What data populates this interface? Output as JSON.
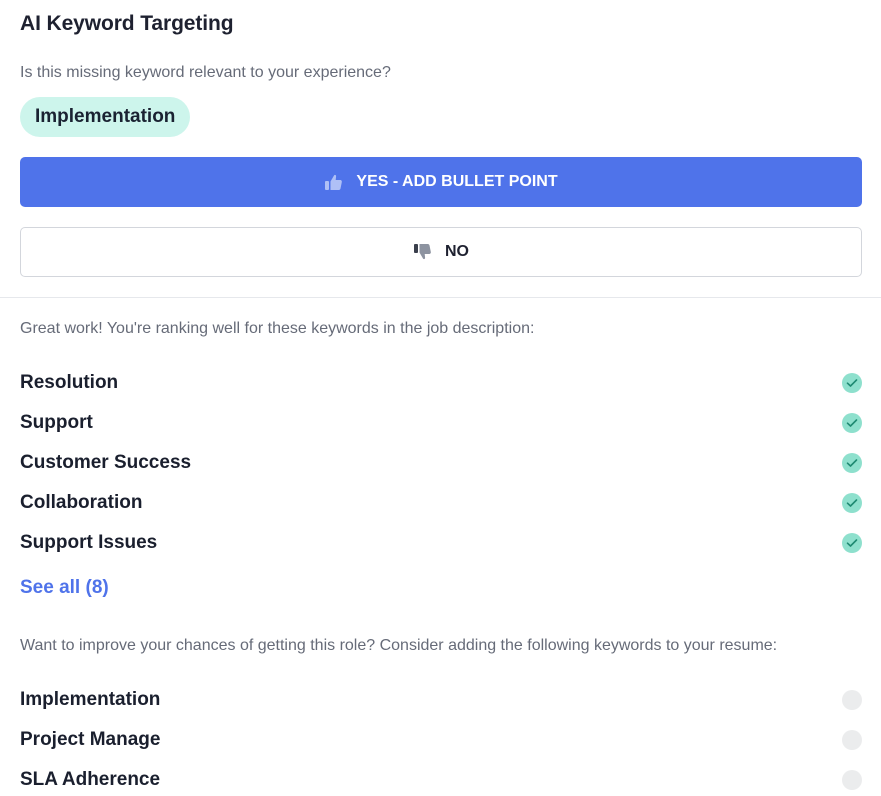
{
  "title": "AI Keyword Targeting",
  "question": "Is this missing keyword relevant to your experience?",
  "current_keyword": "Implementation",
  "yes_button": {
    "label": "YES - ADD BULLET POINT",
    "icon": "thumbs-up-icon"
  },
  "no_button": {
    "label": "NO",
    "icon": "thumbs-down-icon"
  },
  "matched_note": "Great work! You're ranking well for these keywords in the job description:",
  "matched_keywords": [
    {
      "label": "Resolution",
      "status": "check-icon"
    },
    {
      "label": "Support",
      "status": "check-icon"
    },
    {
      "label": "Customer Success",
      "status": "check-icon"
    },
    {
      "label": "Collaboration",
      "status": "check-icon"
    },
    {
      "label": "Support Issues",
      "status": "check-icon"
    }
  ],
  "see_all": "See all (8)",
  "missing_note": "Want to improve your chances of getting this role? Consider adding the following keywords to your resume:",
  "missing_keywords": [
    {
      "label": "Implementation",
      "status": "empty-circle"
    },
    {
      "label": "Project Manage",
      "status": "empty-circle"
    },
    {
      "label": "SLA Adherence",
      "status": "empty-circle"
    }
  ],
  "colors": {
    "accent": "#4f73ea",
    "pill_bg": "#cdf5ec",
    "check_bg": "#8ee0cd",
    "check_mark": "#1f8a72",
    "empty_dot": "#ebeced"
  }
}
